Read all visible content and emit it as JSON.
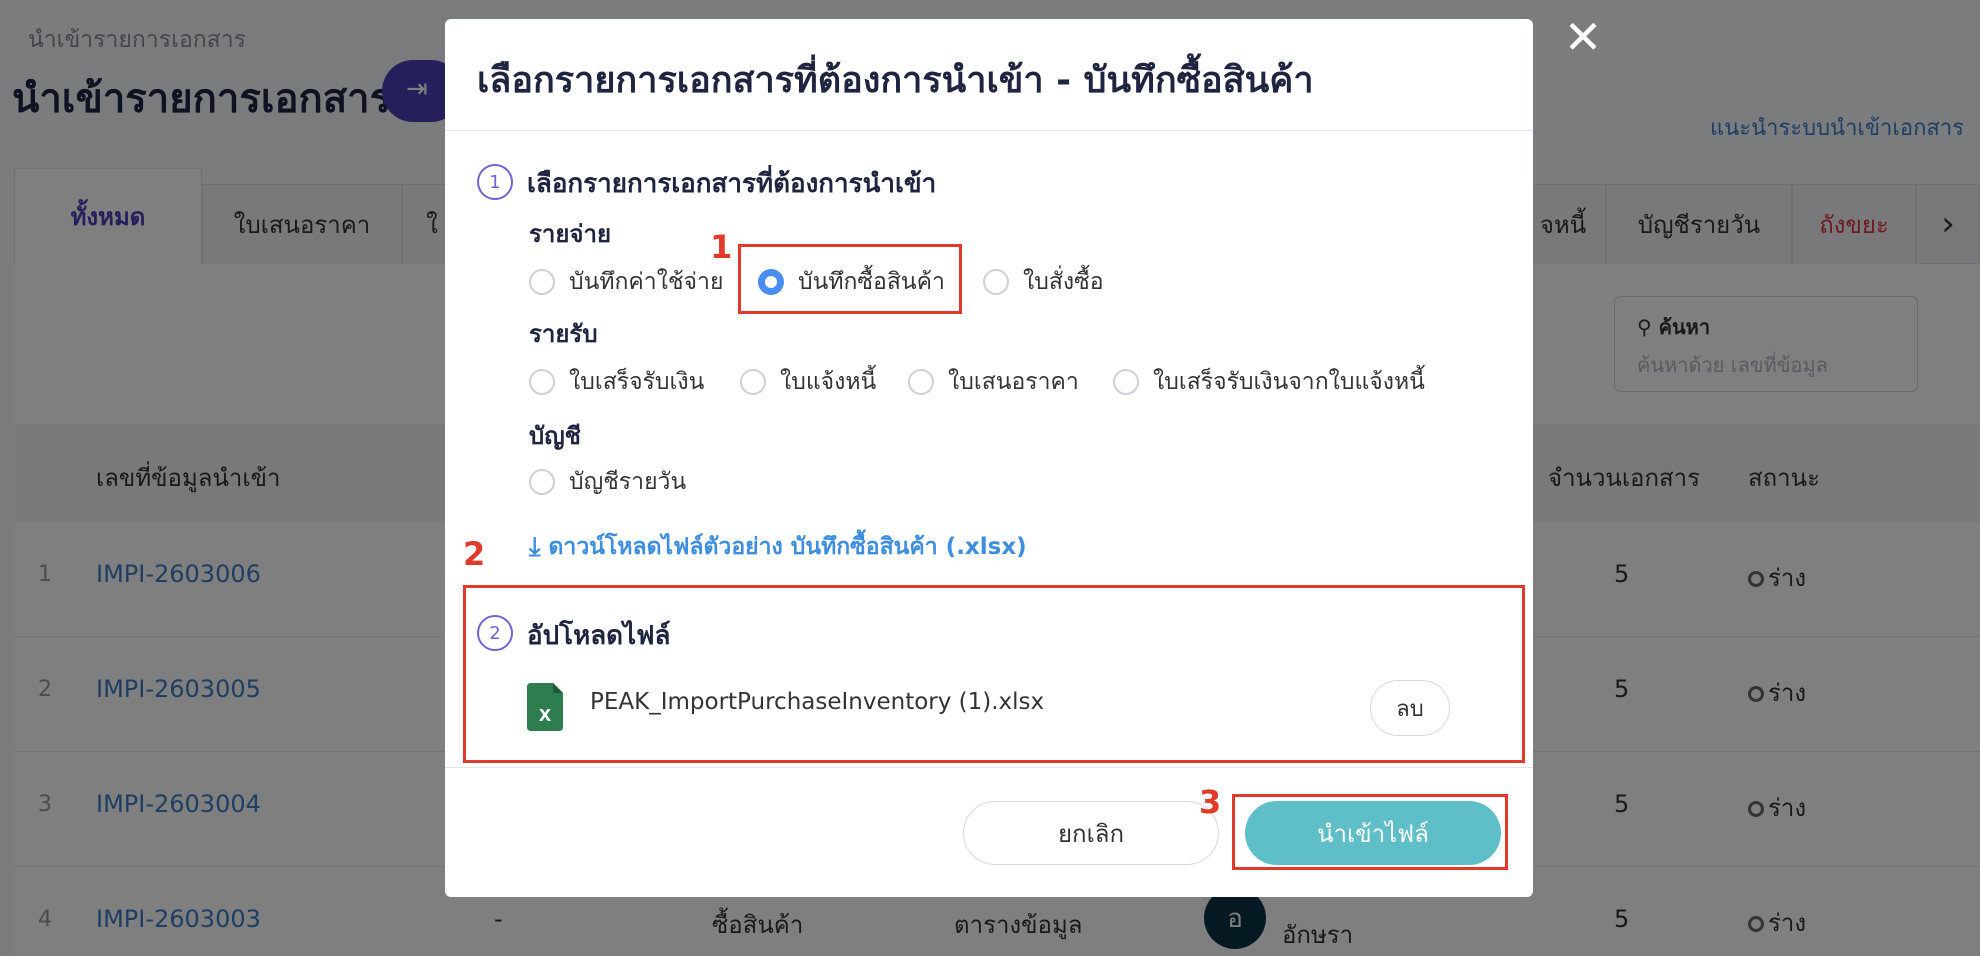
{
  "background": {
    "breadcrumb": "นำเข้ารายการเอกสาร",
    "page_title": "นำเข้ารายการเอกสาร",
    "guide_link": "แนะนำระบบนำเข้าเอกสาร",
    "tabs": [
      "ทั้งหมด",
      "ใบเสนอราคา",
      "ใ",
      "จหนี้",
      "บัญชีรายวัน",
      "ถังขยะ"
    ],
    "search": {
      "label": "ค้นหา",
      "placeholder": "ค้นหาด้วย เลขที่ข้อมูล"
    },
    "columns": {
      "id": "เลขที่ข้อมูลนำเข้า",
      "count": "จำนวนเอกสาร",
      "status": "สถานะ"
    },
    "rows": [
      {
        "num": "1",
        "id": "IMPI-2603006",
        "count": "5",
        "status": "ร่าง"
      },
      {
        "num": "2",
        "id": "IMPI-2603005",
        "count": "5",
        "status": "ร่าง"
      },
      {
        "num": "3",
        "id": "IMPI-2603004",
        "count": "5",
        "status": "ร่าง"
      },
      {
        "num": "4",
        "id": "IMPI-2603003",
        "col2": "-",
        "col3": "ซื้อสินค้า",
        "col4": "ตารางข้อมูล",
        "avatar": "อ",
        "user": "อักษรา",
        "count": "5",
        "status": "ร่าง"
      }
    ]
  },
  "modal": {
    "title": "เลือกรายการเอกสารที่ต้องการนำเข้า - บันทึกซื้อสินค้า",
    "close_icon": "close-icon",
    "step1": {
      "number": "1",
      "title": "เลือกรายการเอกสารที่ต้องการนำเข้า",
      "groups": [
        {
          "label": "รายจ่าย",
          "options": [
            "บันทึกค่าใช้จ่าย",
            "บันทึกซื้อสินค้า",
            "ใบสั่งซื้อ"
          ]
        },
        {
          "label": "รายรับ",
          "options": [
            "ใบเสร็จรับเงิน",
            "ใบแจ้งหนี้",
            "ใบเสนอราคา",
            "ใบเสร็จรับเงินจากใบแจ้งหนี้"
          ]
        },
        {
          "label": "บัญชี",
          "options": [
            "บัญชีรายวัน"
          ]
        }
      ],
      "selected": "บันทึกซื้อสินค้า",
      "download_link": "ดาวน์โหลดไฟล์ตัวอย่าง บันทึกซื้อสินค้า (.xlsx)"
    },
    "step2": {
      "number": "2",
      "title": "อัปโหลดไฟล์",
      "file_name": "PEAK_ImportPurchaseInventory (1).xlsx",
      "delete_label": "ลบ"
    },
    "footer": {
      "cancel": "ยกเลิก",
      "import": "นำเข้าไฟล์"
    }
  },
  "annotations": [
    "1",
    "2",
    "3"
  ],
  "colors": {
    "accent": "#4a3fb8",
    "link": "#3e8ee0",
    "primary_button": "#5fbfc8",
    "annotation": "#e13a2b",
    "radio_selected": "#4a8df0"
  }
}
